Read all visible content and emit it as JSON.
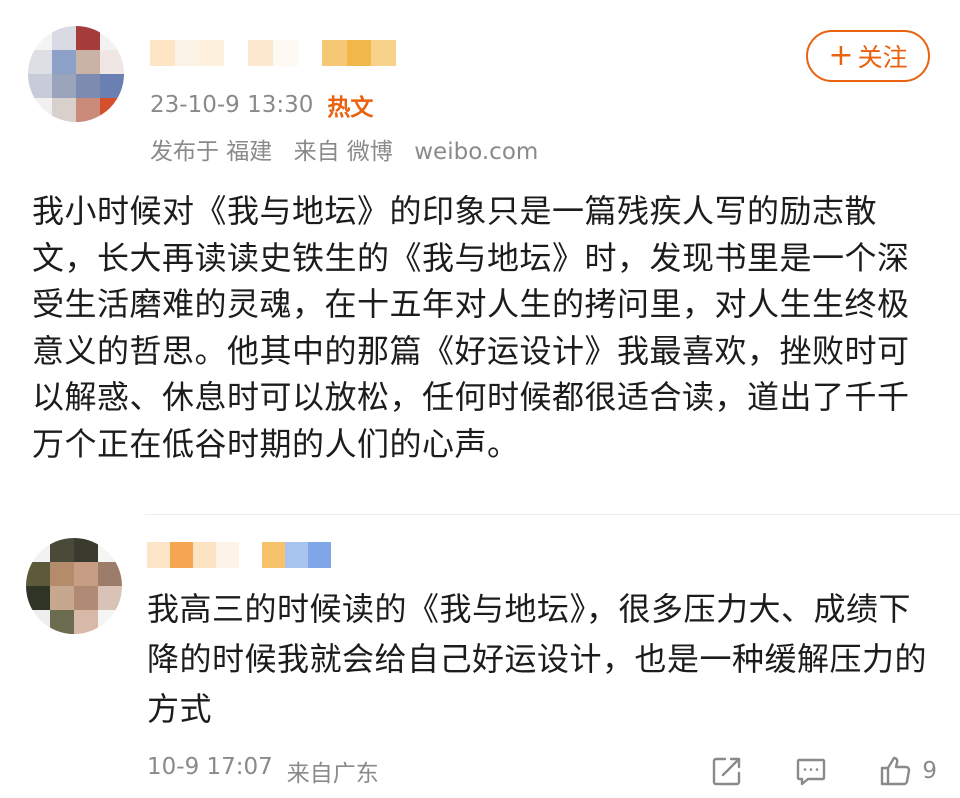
{
  "post": {
    "time": "23-10-9 13:30",
    "badge": "热文",
    "location": "发布于 福建",
    "source": "来自 微博",
    "site": "weibo.com",
    "follow_label": "关注",
    "text": "我小时候对《我与地坛》的印象只是一篇残疾人写的励志散文，长大再读读史铁生的《我与地坛》时，发现书里是一个深受生活磨难的灵魂，在十五年对人生的拷问里，对人生生终极意义的哲思。他其中的那篇《好运设计》我最喜欢，挫败时可以解惑、休息时可以放松，任何时候都很适合读，道出了千千万个正在低谷时期的人们的心声。"
  },
  "comment": {
    "text": "我高三的时候读的《我与地坛》，很多压力大、成绩下降的时候我就会给自己好运设计，也是一种缓解压力的方式",
    "time": "10-9 17:07",
    "source": "来自广东",
    "like_count": "9"
  },
  "icons": {
    "share": "share-icon",
    "reply": "comment-icon",
    "like": "thumbs-up-icon"
  },
  "colors": {
    "accent": "#e8620f",
    "meta": "#8a8a8a",
    "text": "#1c1c1c"
  }
}
